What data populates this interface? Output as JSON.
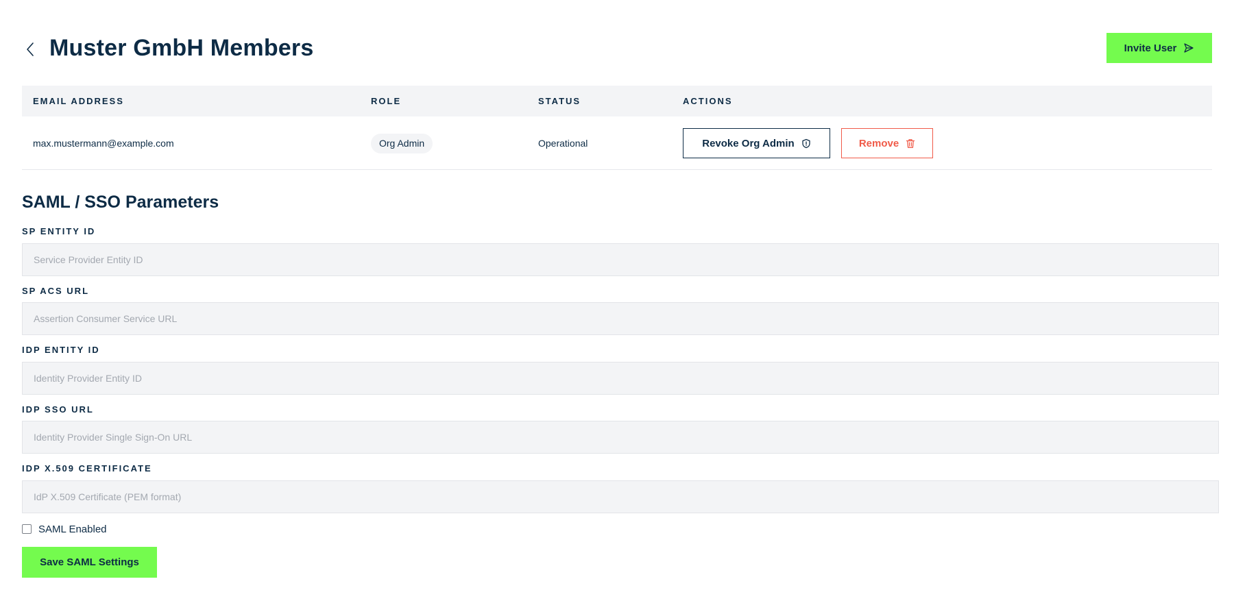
{
  "header": {
    "title": "Muster GmbH Members",
    "invite_label": "Invite User"
  },
  "members_table": {
    "columns": [
      "EMAIL ADDRESS",
      "ROLE",
      "STATUS",
      "ACTIONS"
    ],
    "rows": [
      {
        "email": "max.mustermann@example.com",
        "role": "Org Admin",
        "status": "Operational",
        "revoke_label": "Revoke Org Admin",
        "remove_label": "Remove"
      }
    ]
  },
  "saml": {
    "title": "SAML / SSO Parameters",
    "fields": [
      {
        "label": "SP ENTITY ID",
        "placeholder": "Service Provider Entity ID",
        "value": ""
      },
      {
        "label": "SP ACS URL",
        "placeholder": "Assertion Consumer Service URL",
        "value": ""
      },
      {
        "label": "IDP ENTITY ID",
        "placeholder": "Identity Provider Entity ID",
        "value": ""
      },
      {
        "label": "IDP SSO URL",
        "placeholder": "Identity Provider Single Sign-On URL",
        "value": ""
      },
      {
        "label": "IDP X.509 CERTIFICATE",
        "placeholder": "IdP X.509 Certificate (PEM format)",
        "value": ""
      }
    ],
    "enabled_label": "SAML Enabled",
    "enabled": false,
    "save_label": "Save SAML Settings"
  },
  "colors": {
    "accent_green": "#74fb4e",
    "navy_text": "#0d2b45",
    "danger_red": "#f05a48",
    "input_bg": "#f3f4f6"
  },
  "icons": {
    "back": "chevron-left-icon",
    "invite": "send-icon",
    "revoke": "shield-icon",
    "remove": "trash-icon"
  }
}
